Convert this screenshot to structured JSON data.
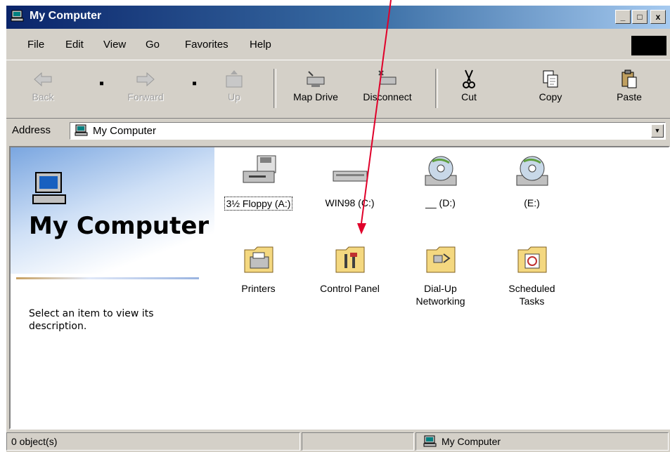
{
  "window": {
    "title": "My Computer",
    "minimize": "_",
    "maximize": "□",
    "close": "x"
  },
  "menu": [
    "File",
    "Edit",
    "View",
    "Go",
    "Favorites",
    "Help"
  ],
  "toolbar": [
    {
      "label": "Back",
      "icon": "back-arrow-icon",
      "enabled": false
    },
    {
      "label": "Forward",
      "icon": "forward-arrow-icon",
      "enabled": false
    },
    {
      "label": "Up",
      "icon": "up-folder-icon",
      "enabled": false
    },
    {
      "label": "Map Drive",
      "icon": "map-drive-icon",
      "enabled": true
    },
    {
      "label": "Disconnect",
      "icon": "disconnect-drive-icon",
      "enabled": true
    },
    {
      "label": "Cut",
      "icon": "scissors-icon",
      "enabled": true
    },
    {
      "label": "Copy",
      "icon": "copy-icon",
      "enabled": true
    },
    {
      "label": "Paste",
      "icon": "paste-icon",
      "enabled": true
    }
  ],
  "address": {
    "label": "Address",
    "value": "My Computer"
  },
  "sidebar": {
    "title": "My Computer",
    "description": "Select an item to view its description."
  },
  "items": [
    {
      "label": "3½ Floppy (A:)",
      "icon": "floppy-drive-icon",
      "focused": true
    },
    {
      "label": "WIN98 (C:)",
      "icon": "hard-drive-icon"
    },
    {
      "label": "__ (D:)",
      "icon": "cd-drive-icon"
    },
    {
      "label": "(E:)",
      "icon": "cd-drive-icon"
    },
    {
      "label": "Printers",
      "icon": "printers-folder-icon"
    },
    {
      "label": "Control Panel",
      "icon": "control-panel-folder-icon"
    },
    {
      "label": "Dial-Up Networking",
      "icon": "dialup-networking-folder-icon"
    },
    {
      "label": "Scheduled Tasks",
      "icon": "scheduled-tasks-folder-icon"
    }
  ],
  "statusbar": {
    "objects": "0 object(s)",
    "location": "My Computer"
  },
  "colors": {
    "titlebar": "#0a246a",
    "face": "#d4d0c8",
    "annotation_arrow": "#e0002a"
  }
}
